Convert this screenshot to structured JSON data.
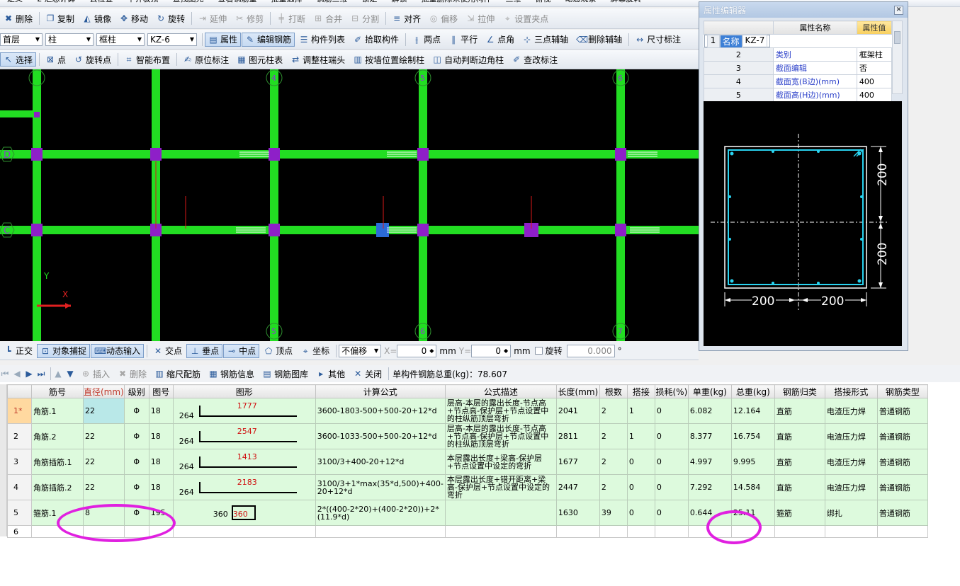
{
  "top_strip": {
    "items": [
      "定义",
      "Σ 汇总计算",
      "云检查",
      "平齐板顶",
      "查找图元",
      "查看钢筋量",
      "批量选择",
      "钢筋三维",
      "锁定",
      "解锁",
      "批量删除未使用构件",
      "三维",
      "俯视",
      "动态观察",
      "屏幕旋转"
    ]
  },
  "toolbar1": {
    "items": [
      {
        "label": "删除",
        "icon": "delete-icon",
        "disabled": false
      },
      {
        "label": "复制",
        "icon": "copy-icon",
        "disabled": false
      },
      {
        "label": "镜像",
        "icon": "mirror-icon",
        "disabled": false
      },
      {
        "label": "移动",
        "icon": "move-icon",
        "disabled": false
      },
      {
        "label": "旋转",
        "icon": "rotate-icon",
        "disabled": false
      },
      {
        "label": "延伸",
        "icon": "extend-icon",
        "disabled": true
      },
      {
        "label": "修剪",
        "icon": "trim-icon",
        "disabled": true
      },
      {
        "label": "打断",
        "icon": "break-icon",
        "disabled": true
      },
      {
        "label": "合并",
        "icon": "merge-icon",
        "disabled": true
      },
      {
        "label": "分割",
        "icon": "split-icon",
        "disabled": true
      },
      {
        "label": "对齐",
        "icon": "align-icon",
        "disabled": false
      },
      {
        "label": "偏移",
        "icon": "offset-icon",
        "disabled": true
      },
      {
        "label": "拉伸",
        "icon": "stretch-icon",
        "disabled": true
      },
      {
        "label": "设置夹点",
        "icon": "grip-icon",
        "disabled": true
      }
    ]
  },
  "toolbar2": {
    "floor": "首层",
    "category": "柱",
    "type": "框柱",
    "component": "KZ-6",
    "items": [
      {
        "label": "属性",
        "icon": "property-icon",
        "on": true
      },
      {
        "label": "编辑钢筋",
        "icon": "edit-rebar-icon",
        "on": true
      },
      {
        "label": "构件列表",
        "icon": "list-icon",
        "on": false
      },
      {
        "label": "拾取构件",
        "icon": "pick-icon",
        "on": false
      },
      {
        "label": "两点",
        "icon": "two-point-icon",
        "on": false
      },
      {
        "label": "平行",
        "icon": "parallel-icon",
        "on": false
      },
      {
        "label": "点角",
        "icon": "point-angle-icon",
        "on": false
      },
      {
        "label": "三点辅轴",
        "icon": "three-point-icon",
        "on": false
      },
      {
        "label": "删除辅轴",
        "icon": "delete-axis-icon",
        "on": false
      },
      {
        "label": "尺寸标注",
        "icon": "dimension-icon",
        "on": false
      }
    ]
  },
  "toolbar3": {
    "items": [
      {
        "label": "选择",
        "icon": "select-icon",
        "on": true
      },
      {
        "label": "点",
        "icon": "point-icon",
        "on": false
      },
      {
        "label": "旋转点",
        "icon": "rotate-point-icon",
        "on": false
      },
      {
        "label": "智能布置",
        "icon": "smart-layout-icon",
        "on": false
      },
      {
        "label": "原位标注",
        "icon": "in-place-annotation-icon",
        "on": false
      },
      {
        "label": "图元柱表",
        "icon": "column-table-icon",
        "on": false
      },
      {
        "label": "调整柱端头",
        "icon": "adjust-end-icon",
        "on": false
      },
      {
        "label": "按墙位置绘制柱",
        "icon": "wall-column-icon",
        "on": false
      },
      {
        "label": "自动判断边角柱",
        "icon": "auto-corner-icon",
        "on": false
      },
      {
        "label": "查改标注",
        "icon": "edit-annotation-icon",
        "on": false
      }
    ]
  },
  "canvas": {
    "axis_labels_top": [
      "4",
      "5",
      "6",
      "7"
    ],
    "axis_labels_bottom": [
      "5",
      "6",
      "7"
    ],
    "row_labels": [
      "D",
      "C"
    ],
    "ucs_x": "X",
    "ucs_y": "Y",
    "colors": {
      "beam": "#22dd22",
      "column": "#8e1fc8",
      "background": "#000000"
    }
  },
  "property_editor": {
    "title": "属性编辑器",
    "col_name": "属性名称",
    "col_value": "属性值",
    "rows": [
      {
        "n": "1",
        "name": "名称",
        "value": "KZ-7"
      },
      {
        "n": "2",
        "name": "类别",
        "value": "框架柱"
      },
      {
        "n": "3",
        "name": "截面编辑",
        "value": "否"
      },
      {
        "n": "4",
        "name": "截面宽(B边)(mm)",
        "value": "400"
      },
      {
        "n": "5",
        "name": "截面高(H边)(mm)",
        "value": "400"
      }
    ],
    "dims": {
      "right_top": "200",
      "right_bottom": "200",
      "bottom_left": "200",
      "bottom_right": "200"
    }
  },
  "snapbar": {
    "items": [
      {
        "label": "正交",
        "icon": "ortho-icon",
        "on": false
      },
      {
        "label": "对象捕捉",
        "icon": "object-snap-icon",
        "on": true
      },
      {
        "label": "动态输入",
        "icon": "dynamic-input-icon",
        "on": true
      },
      {
        "label": "交点",
        "icon": "intersection-icon",
        "on": false
      },
      {
        "label": "垂点",
        "icon": "perpendicular-icon",
        "on": true
      },
      {
        "label": "中点",
        "icon": "midpoint-icon",
        "on": true
      },
      {
        "label": "顶点",
        "icon": "vertex-icon",
        "on": false
      },
      {
        "label": "坐标",
        "icon": "coordinate-icon",
        "on": false
      }
    ],
    "offset_mode": "不偏移",
    "x_label": "X=",
    "x_value": "0",
    "y_label": "Y=",
    "y_value": "0",
    "unit": "mm",
    "rotate_label": "旋转",
    "rotate_value": "0.000",
    "degree": "°"
  },
  "grid_toolbar": {
    "items": [
      "插入",
      "删除",
      "缩尺配筋",
      "钢筋信息",
      "钢筋图库",
      "其他",
      "关闭"
    ],
    "total_label": "单构件钢筋总重(kg)：78.607"
  },
  "rebar_table": {
    "headers": [
      "筋号",
      "直径(mm)",
      "级别",
      "图号",
      "图形",
      "计算公式",
      "公式描述",
      "长度(mm)",
      "根数",
      "搭接",
      "损耗(%)",
      "单重(kg)",
      "总重(kg)",
      "钢筋归类",
      "搭接形式",
      "钢筋类型"
    ],
    "rows": [
      {
        "rn": "1*",
        "name": "角筋.1",
        "dia": "22",
        "grade": "Φ",
        "fig": "18",
        "shape_a": "264",
        "shape_b": "1777",
        "formula": "3600-1803-500+500-20+12*d",
        "desc": "层高-本层的露出长度-节点高+节点高-保护层+节点设置中的柱纵筋顶层弯折",
        "len": "2041",
        "count": "2",
        "lap": "1",
        "loss": "0",
        "unit_w": "6.082",
        "total_w": "12.164",
        "cls": "直筋",
        "lap_type": "电渣压力焊",
        "rtype": "普通钢筋"
      },
      {
        "rn": "2",
        "name": "角筋.2",
        "dia": "22",
        "grade": "Φ",
        "fig": "18",
        "shape_a": "264",
        "shape_b": "2547",
        "formula": "3600-1033-500+500-20+12*d",
        "desc": "层高-本层的露出长度-节点高+节点高-保护层+节点设置中的柱纵筋顶层弯折",
        "len": "2811",
        "count": "2",
        "lap": "1",
        "loss": "0",
        "unit_w": "8.377",
        "total_w": "16.754",
        "cls": "直筋",
        "lap_type": "电渣压力焊",
        "rtype": "普通钢筋"
      },
      {
        "rn": "3",
        "name": "角筋插筋.1",
        "dia": "22",
        "grade": "Φ",
        "fig": "18",
        "shape_a": "264",
        "shape_b": "1413",
        "formula": "3100/3+400-20+12*d",
        "desc": "本层露出长度+梁高-保护层+节点设置中设定的弯折",
        "len": "1677",
        "count": "2",
        "lap": "0",
        "loss": "0",
        "unit_w": "4.997",
        "total_w": "9.995",
        "cls": "直筋",
        "lap_type": "电渣压力焊",
        "rtype": "普通钢筋"
      },
      {
        "rn": "4",
        "name": "角筋插筋.2",
        "dia": "22",
        "grade": "Φ",
        "fig": "18",
        "shape_a": "264",
        "shape_b": "2183",
        "formula": "3100/3+1*max(35*d,500)+400-20+12*d",
        "desc": "本层露出长度+错开距离+梁高-保护层+节点设置中设定的弯折",
        "len": "2447",
        "count": "2",
        "lap": "0",
        "loss": "0",
        "unit_w": "7.292",
        "total_w": "14.584",
        "cls": "直筋",
        "lap_type": "电渣压力焊",
        "rtype": "普通钢筋"
      },
      {
        "rn": "5",
        "name": "箍筋.1",
        "dia": "8",
        "grade": "Φ",
        "fig": "195",
        "shape_a": "360",
        "shape_b": "360",
        "formula": "2*((400-2*20)+(400-2*20))+2*(11.9*d)",
        "desc": "",
        "len": "1630",
        "count": "39",
        "lap": "0",
        "loss": "0",
        "unit_w": "0.644",
        "total_w": "25.11",
        "cls": "箍筋",
        "lap_type": "绑扎",
        "rtype": "普通钢筋"
      }
    ],
    "empty_row": "6"
  }
}
